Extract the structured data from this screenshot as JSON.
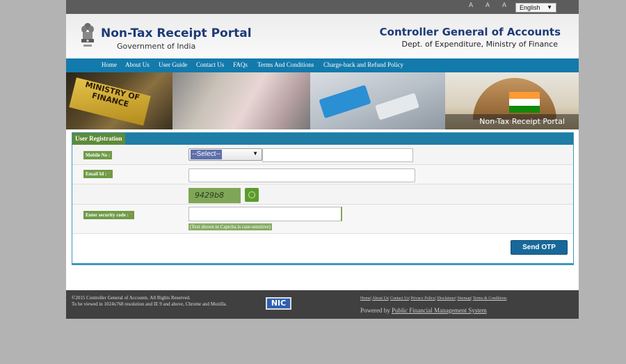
{
  "topbar": {
    "font_size_controls": [
      "A",
      "A",
      "A"
    ],
    "language": "English"
  },
  "header": {
    "title": "Non-Tax Receipt Portal",
    "subtitle": "Government of India",
    "org_title": "Controller General of Accounts",
    "org_subtitle": "Dept. of Expenditure, Ministry of Finance"
  },
  "nav": {
    "items": [
      "Home",
      "About Us",
      "User Guide",
      "Contact Us",
      "FAQs",
      "Terms And Conditions",
      "Charge-back and Refund Policy"
    ]
  },
  "banner": {
    "sign_line1": "MINISTRY OF",
    "sign_line2": "FINANCE",
    "caption": "Non-Tax Receipt Portal"
  },
  "form": {
    "heading": "User Registration",
    "mobile_label": "Mobile No :",
    "mobile_select": "--Select--",
    "mobile_value": "",
    "email_label": "Email Id :",
    "email_value": "",
    "captcha_text": "9429b8",
    "security_label": "Enter security code :",
    "security_value": "",
    "captcha_hint": "(Text shown in Captcha is case-sensitive)",
    "required_marker": "*",
    "submit_label": "Send OTP"
  },
  "footer": {
    "copyright": "©2015 Controller General of Accounts. All Rights Reserved.",
    "resolution_note": "To be viewed in 1024x768 resolution and IE 9 and above, Chrome and Mozilla.",
    "nic_logo": "NIC",
    "links": [
      "Home",
      "About Us",
      "Contact Us",
      "Privacy Policy",
      "Disclaimer",
      "Sitemap",
      "Terms & Conditions"
    ],
    "powered_prefix": "Powered by",
    "powered_link": "Public Financial Management System"
  },
  "colors": {
    "nav_blue": "#137aac",
    "panel_header": "#1f7da6",
    "label_green": "#6f9b46",
    "button_blue": "#17689a",
    "footer_dark": "#404040"
  }
}
